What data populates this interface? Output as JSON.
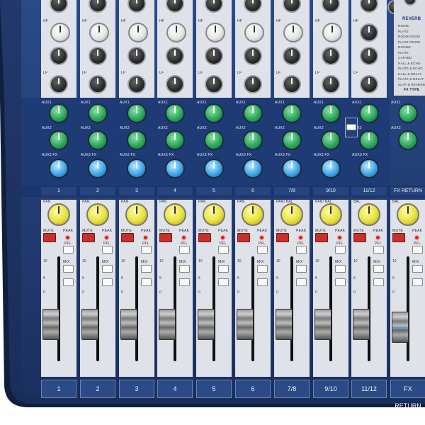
{
  "channels": [
    {
      "label": "1",
      "bottom_label": "1",
      "pan_label": "PAN"
    },
    {
      "label": "2",
      "bottom_label": "2",
      "pan_label": "PAN"
    },
    {
      "label": "3",
      "bottom_label": "3",
      "pan_label": "PAN"
    },
    {
      "label": "4",
      "bottom_label": "4",
      "pan_label": "PAN"
    },
    {
      "label": "5",
      "bottom_label": "5",
      "pan_label": "PAN"
    },
    {
      "label": "6",
      "bottom_label": "6",
      "pan_label": "PAN"
    },
    {
      "label": "7/8",
      "bottom_label": "7/8",
      "pan_label": "PAN/ BAL"
    },
    {
      "label": "9/10",
      "bottom_label": "9/10",
      "pan_label": "PAN/ BAL"
    },
    {
      "label": "11/12",
      "bottom_label": "11/12",
      "pan_label": "BAL"
    },
    {
      "label": "FX RETURN",
      "bottom_label": "FX RETURN",
      "pan_label": "BAL"
    }
  ],
  "controls": {
    "hf": "HF",
    "lf": "LF",
    "aux1": "AUX1",
    "aux2": "AUX2",
    "aux3": "AUX3 FX",
    "mute": "MUTE",
    "peak": "PEAK",
    "pfl": "PFL",
    "mix": "MIX",
    "fader_scale": [
      "10",
      "5",
      "0"
    ]
  },
  "reverb": {
    "title": "REVERB",
    "presets": [
      "ROOM",
      "PLATE",
      "ROOM ROOM",
      "PLATE ROOM",
      "ROOMS",
      "PLATE",
      "CATHED",
      "HALL & ECHO",
      "PLATE & ECHO",
      "HALL & DELAY",
      "PLATE & DELAY",
      "SLAP & REVERB"
    ],
    "fx_type": "FX TYPE"
  },
  "colors": {
    "body": "#1e3a74",
    "panel": "#dfe2e8",
    "aux_green": "#2aa85a",
    "fx_blue": "#3fa8e8",
    "pan_yellow": "#e8e23a",
    "mute_red": "#c9302c"
  }
}
